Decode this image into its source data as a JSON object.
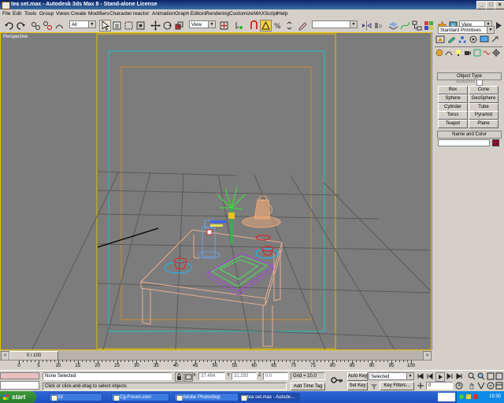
{
  "window": {
    "title": "tea set.max - Autodesk 3ds Max 8 - Stand-alone License"
  },
  "menu": [
    "File",
    "Edit",
    "Tools",
    "Group",
    "Views",
    "Create",
    "Modifiers",
    "Character",
    "reactor",
    "Animation",
    "Graph Editors",
    "Rendering",
    "Customize",
    "MAXScript",
    "Help"
  ],
  "toolbar": {
    "selection_filter": "All",
    "ref_coord": "View",
    "named_selection": "",
    "render_view": "View"
  },
  "viewport": {
    "label": "Perspective"
  },
  "command_panel": {
    "category": "Standard Primitives",
    "object_type_title": "Object Type",
    "autogrid_label": "AutoGrid",
    "buttons": [
      "Box",
      "Cone",
      "Sphere",
      "GeoSphere",
      "Cylinder",
      "Tube",
      "Torus",
      "Pyramid",
      "Teapot",
      "Plane"
    ],
    "name_color_title": "Name and Color",
    "object_color": "#8a0a2a"
  },
  "timeline": {
    "frame_display": "0 / 100"
  },
  "track": {
    "ticks": [
      "0",
      "5",
      "10",
      "15",
      "20",
      "25",
      "30",
      "35",
      "40",
      "45",
      "50",
      "55",
      "60",
      "65",
      "70",
      "75",
      "80",
      "85",
      "90",
      "95",
      "100"
    ]
  },
  "status": {
    "selection": "None Selected",
    "prompt": "Click or click-and-drag to select objects",
    "x_label": "X",
    "x_value": "37.494",
    "y_label": "Y",
    "y_value": "31.293",
    "z_label": "Z",
    "z_value": "0.0",
    "grid": "Grid = 10.0",
    "add_time_tag": "Add Time Tag",
    "auto_key": "Auto Key",
    "set_key": "Set Key",
    "key_mode": "Selected",
    "key_filters": "Key Filters...",
    "current_frame": "0"
  },
  "taskbar": {
    "start_label": "start",
    "tasks": [
      "2d",
      "Cg-Forum.com",
      "Adobe Photoshop",
      "tea set.max - Autode..."
    ],
    "clock": "19:30"
  }
}
